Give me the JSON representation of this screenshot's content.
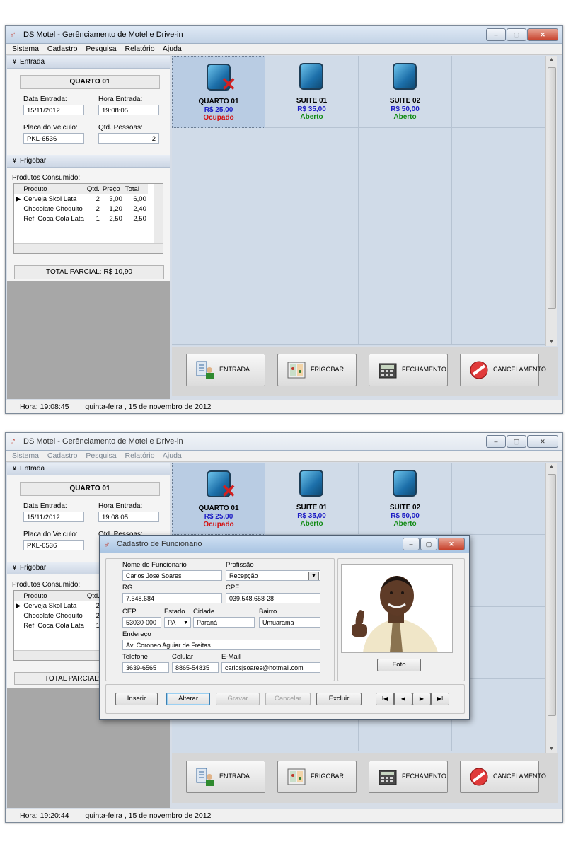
{
  "screens": [
    {
      "app_title": "DS Motel - Gerênciamento de Motel e Drive-in",
      "window_buttons": {
        "minimize": "–",
        "maximize": "▢",
        "close": "✕"
      },
      "menu": [
        "Sistema",
        "Cadastro",
        "Pesquisa",
        "Relatório",
        "Ajuda"
      ],
      "entrada": {
        "header": "Entrada",
        "room_title": "QUARTO 01",
        "data_entrada_label": "Data Entrada:",
        "data_entrada": "15/11/2012",
        "hora_entrada_label": "Hora Entrada:",
        "hora_entrada": "19:08:05",
        "placa_label": "Placa do Veiculo:",
        "placa": "PKL-6536",
        "pessoas_label": "Qtd. Pessoas:",
        "pessoas": "2"
      },
      "frigobar": {
        "header": "Frigobar",
        "produtos_label": "Produtos Consumido:",
        "columns": [
          "Produto",
          "Qtd.",
          "Preço",
          "Total"
        ],
        "rows": [
          [
            "Cerveja Skol Lata",
            "2",
            "3,00",
            "6,00"
          ],
          [
            "Chocolate Choquito",
            "2",
            "1,20",
            "2,40"
          ],
          [
            "Ref. Coca Cola Lata",
            "1",
            "2,50",
            "2,50"
          ]
        ],
        "total_parcial": "TOTAL PARCIAL:  R$ 10,90"
      },
      "rooms": [
        {
          "name": "QUARTO 01",
          "price": "R$ 25,00",
          "status": "Ocupado"
        },
        {
          "name": "SUITE 01",
          "price": "R$ 35,00",
          "status": "Aberto"
        },
        {
          "name": "SUITE 02",
          "price": "R$ 50,00",
          "status": "Aberto"
        }
      ],
      "actions": [
        "ENTRADA",
        "FRIGOBAR",
        "FECHAMENTO",
        "CANCELAMENTO"
      ],
      "status": {
        "hora": "Hora:  19:08:45",
        "data": "quinta-feira ,  15 de novembro de 2012"
      }
    },
    {
      "app_title": "DS Motel - Gerênciamento de Motel e Drive-in",
      "window_buttons": {
        "minimize": "–",
        "maximize": "▢",
        "close": "✕"
      },
      "menu": [
        "Sistema",
        "Cadastro",
        "Pesquisa",
        "Relatório",
        "Ajuda"
      ],
      "entrada": {
        "header": "Entrada",
        "room_title": "QUARTO 01",
        "data_entrada_label": "Data Entrada:",
        "data_entrada": "15/11/2012",
        "hora_entrada_label": "Hora Entrada:",
        "hora_entrada": "19:08:05",
        "placa_label": "Placa do Veiculo:",
        "placa": "PKL-6536",
        "pessoas_label_partial": "Qtd. Pessoas:"
      },
      "frigobar": {
        "header": "Frigobar",
        "produtos_label": "Produtos Consumido:",
        "columns": [
          "Produto",
          "Qtd."
        ],
        "rows": [
          [
            "Cerveja Skol Lata",
            "2"
          ],
          [
            "Chocolate Choquito",
            "2"
          ],
          [
            "Ref. Coca Cola Lata",
            "1"
          ]
        ],
        "total_parcial": "TOTAL PARCIAL:"
      },
      "rooms": [
        {
          "name": "QUARTO 01",
          "price": "R$ 25,00",
          "status": "Ocupado"
        },
        {
          "name": "SUITE 01",
          "price": "R$ 35,00",
          "status": "Aberto"
        },
        {
          "name": "SUITE 02",
          "price": "R$ 50,00",
          "status": "Aberto"
        }
      ],
      "actions": [
        "ENTRADA",
        "FRIGOBAR",
        "FECHAMENTO",
        "CANCELAMENTO"
      ],
      "status": {
        "hora": "Hora:  19:20:44",
        "data": "quinta-feira ,  15 de novembro de 2012"
      },
      "dialog": {
        "title": "Cadastro de Funcionario",
        "nome_label": "Nome do Funcionario",
        "nome": "Carlos José Soares",
        "profissao_label": "Profissão",
        "profissao": "Recepção",
        "rg_label": "RG",
        "rg": "7.548.684",
        "cpf_label": "CPF",
        "cpf": "039.548.658-28",
        "cep_label": "CEP",
        "cep": "53030-000",
        "estado_label": "Estado",
        "estado": "PA",
        "cidade_label": "Cidade",
        "cidade": "Paraná",
        "bairro_label": "Bairro",
        "bairro": "Umuarama",
        "endereco_label": "Endereço",
        "endereco": "Av. Coroneo Aguiar de Freitas",
        "telefone_label": "Telefone",
        "telefone": "3639-6565",
        "celular_label": "Celular",
        "celular": "8865-54835",
        "email_label": "E-Mail",
        "email": "carlosjsoares@hotmail.com",
        "foto_button": "Foto",
        "buttons": [
          "Inserir",
          "Alterar",
          "Gravar",
          "Cancelar",
          "Excluir"
        ],
        "nav": [
          "I◀",
          "◀",
          "▶",
          "▶I"
        ]
      }
    }
  ]
}
